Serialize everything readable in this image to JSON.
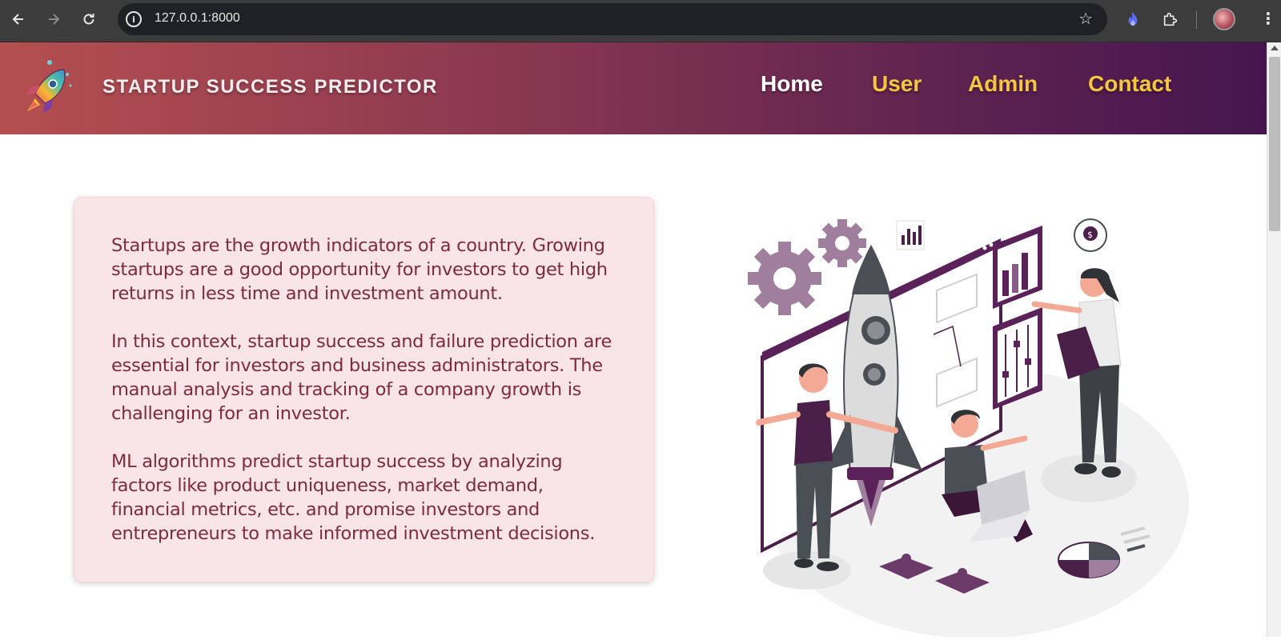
{
  "browser": {
    "url": "127.0.0.1:8000",
    "info_glyph": "i",
    "star_glyph": "☆",
    "menu_glyph": "⋮",
    "icons": [
      "back-arrow-icon",
      "forward-arrow-icon",
      "reload-icon",
      "site-info-icon",
      "bookmark-star-icon",
      "extension-flame-icon",
      "extensions-puzzle-icon",
      "profile-avatar",
      "kebab-menu-icon"
    ]
  },
  "header": {
    "brand": "STARTUP SUCCESS PREDICTOR",
    "nav": {
      "home": "Home",
      "user": "User",
      "admin": "Admin",
      "contact": "Contact"
    },
    "colors": {
      "gradient_start": "#b54f50",
      "gradient_end": "#45164e",
      "nav_active": "#ffffff",
      "nav_inactive": "#f6c641"
    }
  },
  "main": {
    "paragraphs": [
      "Startups are the growth indicators of a country. Growing startups are a good opportunity for investors to get high returns in less time and investment amount.",
      "In this context, startup success and failure prediction are essential for investors and business administrators. The manual analysis and tracking of a company growth is challenging for an investor.",
      "ML algorithms predict startup success by analyzing factors like product uniqueness, market demand, financial metrics, etc. and promise investors and entrepreneurs to make informed investment decisions."
    ],
    "colors": {
      "card_bg": "#f9e4e7",
      "text": "#7d2b3e"
    }
  }
}
